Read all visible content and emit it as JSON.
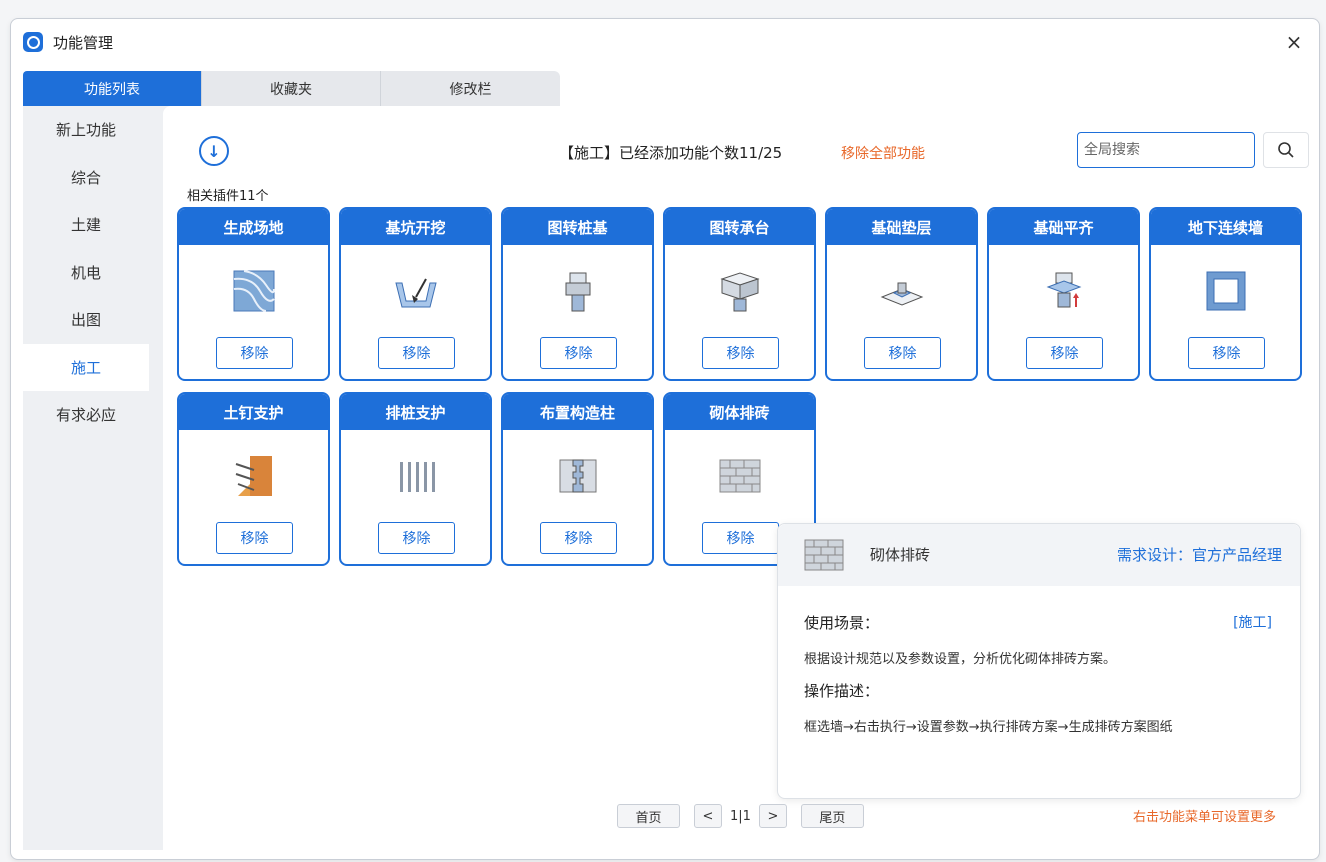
{
  "window": {
    "title": "功能管理",
    "close_glyph": "×"
  },
  "tabs": [
    {
      "label": "功能列表",
      "active": true
    },
    {
      "label": "收藏夹",
      "active": false
    },
    {
      "label": "修改栏",
      "active": false
    }
  ],
  "sidebar": {
    "items": [
      {
        "label": "新上功能"
      },
      {
        "label": "综合"
      },
      {
        "label": "土建"
      },
      {
        "label": "机电"
      },
      {
        "label": "出图"
      },
      {
        "label": "施工",
        "active": true
      },
      {
        "label": "有求必应"
      }
    ]
  },
  "header": {
    "info": "【施工】已经添加功能个数11/25",
    "remove_all": "移除全部功能",
    "related": "相关插件11个",
    "search_placeholder": "全局搜索"
  },
  "cards": [
    {
      "title": "生成场地",
      "remove": "移除",
      "icon": "terrain-icon"
    },
    {
      "title": "基坑开挖",
      "remove": "移除",
      "icon": "excavation-icon"
    },
    {
      "title": "图转桩基",
      "remove": "移除",
      "icon": "pile-icon"
    },
    {
      "title": "图转承台",
      "remove": "移除",
      "icon": "pile-cap-icon"
    },
    {
      "title": "基础垫层",
      "remove": "移除",
      "icon": "foundation-bed-icon"
    },
    {
      "title": "基础平齐",
      "remove": "移除",
      "icon": "foundation-align-icon"
    },
    {
      "title": "地下连续墙",
      "remove": "移除",
      "icon": "diaphragm-wall-icon"
    },
    {
      "title": "土钉支护",
      "remove": "移除",
      "icon": "soil-nail-icon"
    },
    {
      "title": "排桩支护",
      "remove": "移除",
      "icon": "pile-row-icon"
    },
    {
      "title": "布置构造柱",
      "remove": "移除",
      "icon": "construction-column-icon"
    },
    {
      "title": "砌体排砖",
      "remove": "移除",
      "icon": "brick-wall-icon"
    }
  ],
  "popup": {
    "name": "砌体排砖",
    "designer": "需求设计：官方产品经理",
    "scene_label": "使用场景：",
    "tag": "[施工]",
    "scene_text": "根据设计规范以及参数设置，分析优化砌体排砖方案。",
    "op_label": "操作描述：",
    "op_text": "框选墙→右击执行→设置参数→执行排砖方案→生成排砖方案图纸"
  },
  "pager": {
    "first": "首页",
    "prev": "<",
    "page": "1|1",
    "next": ">",
    "last": "尾页"
  },
  "hint": "右击功能菜单可设置更多",
  "colors": {
    "primary": "#1e6fd9",
    "accent": "#e8682a"
  }
}
